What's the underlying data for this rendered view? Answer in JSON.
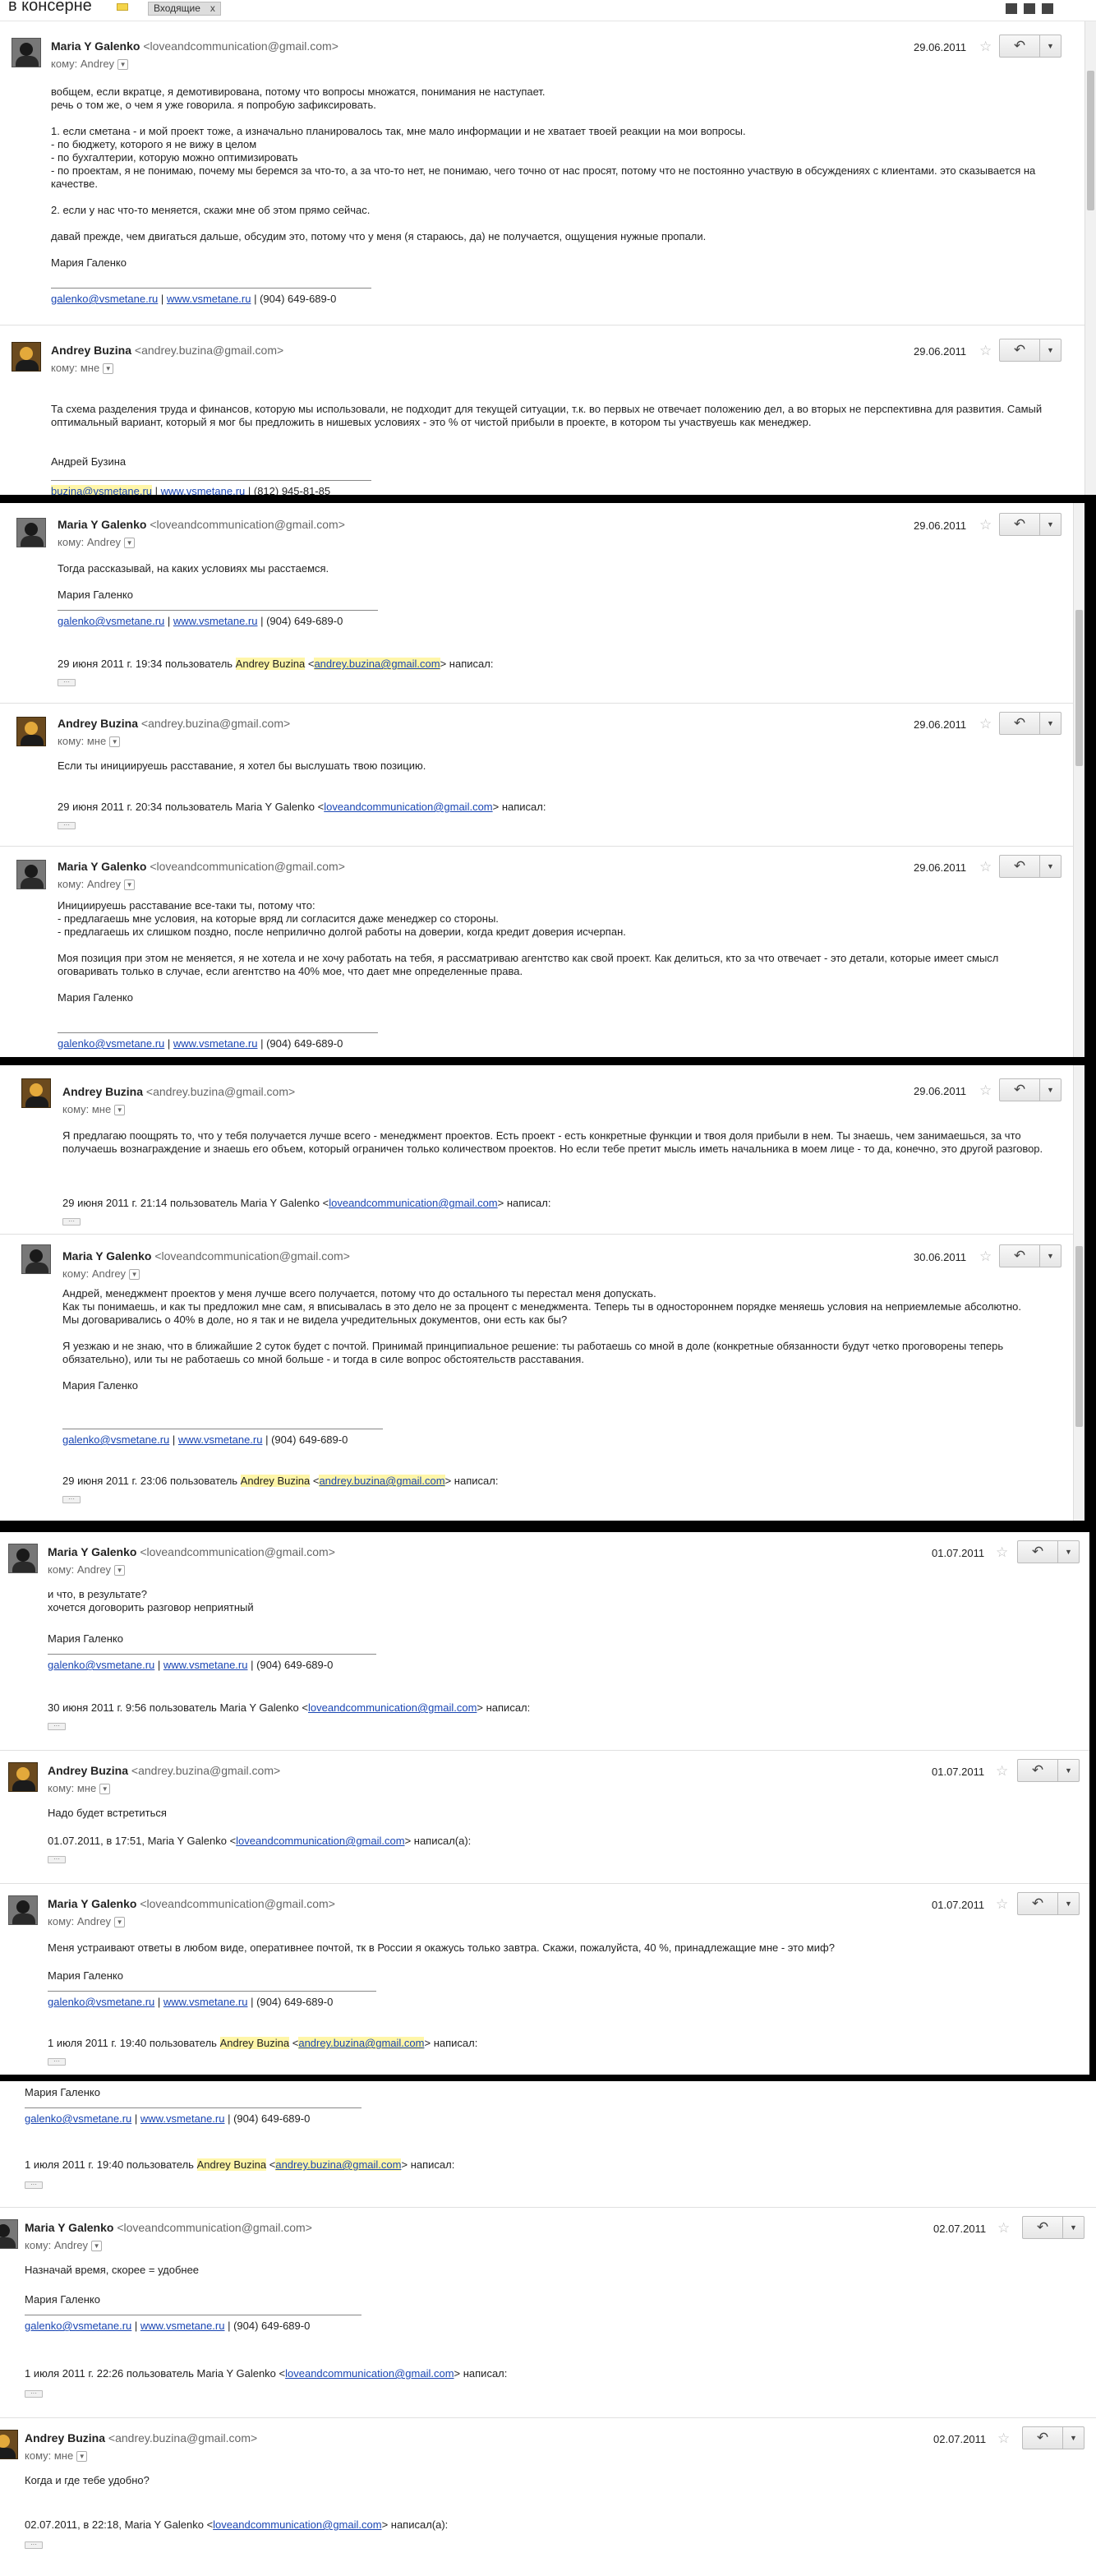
{
  "header": {
    "title": "в консерне",
    "chip_label": "Входящие",
    "chip_close": "x"
  },
  "p1": {
    "m1": {
      "name": "Maria Y Galenko",
      "email": "<loveandcommunication@gmail.com>",
      "to": "кому: Andrey",
      "date": "29.06.2011",
      "lines": [
        "вобщем, если вкратце, я демотивирована, потому что вопросы множатся, понимания не наступает.",
        "речь о том же, о чем я уже говорила. я попробую зафиксировать.",
        "",
        "1. если сметана - и мой проект тоже, а изначально планировалось так, мне мало информации и не хватает твоей реакции на мои вопросы.",
        "- по бюджету, которого я не вижу в целом",
        "- по бухгалтерии, которую можно оптимизировать",
        "- по проектам, я не понимаю, почему мы беремся за что-то, а за что-то нет, не понимаю, чего точно от нас просят, потому что не постоянно участвую в обсуждениях с клиентами. это сказывается на качестве.",
        "",
        "2. если у нас что-то меняется, скажи мне об этом прямо сейчас.",
        "",
        "давай прежде, чем двигаться дальше, обсудим это, потому что у меня (я стараюсь, да) не получается, ощущения нужные пропали.",
        "",
        "Мария Галенко"
      ],
      "sig_email": "galenko@vsmetane.ru",
      "sig_site": "www.vsmetane.ru",
      "sig_phone": "(904) 649-689-0"
    },
    "m2": {
      "name": "Andrey Buzina",
      "email": "<andrey.buzina@gmail.com>",
      "to": "кому: мне",
      "date": "29.06.2011",
      "lines": [
        "Та схема разделения труда и финансов, которую мы использовали, не подходит для текущей ситуации, т.к. во первых не отвечает положению дел, а во вторых не перспективна для развития. Самый оптимальный вариант, который я мог бы предложить в нишевых условиях - это % от чистой прибыли в проекте, в котором ты участвуешь как менеджер.",
        "",
        "",
        "Андрей Бузина"
      ],
      "sig_email": "buzina@vsmetane.ru",
      "sig_site": "www.vsmetane.ru",
      "sig_phone": "(812) 945-81-85"
    }
  },
  "p2": {
    "m1": {
      "name": "Maria Y Galenko",
      "email": "<loveandcommunication@gmail.com>",
      "to": "кому: Andrey",
      "date": "29.06.2011",
      "text": "Тогда рассказывай, на каких условиях мы расстаемся.",
      "signame": "Мария Галенко",
      "sig_email": "galenko@vsmetane.ru",
      "sig_site": "www.vsmetane.ru",
      "sig_phone": "(904) 649-689-0",
      "q_pre": "29 июня 2011 г. 19:34 пользователь ",
      "q_name": "Andrey Buzina",
      "q_email": "andrey.buzina@gmail.com",
      "q_post": " написал:"
    },
    "m2": {
      "name": "Andrey Buzina",
      "email": "<andrey.buzina@gmail.com>",
      "to": "кому: мне",
      "date": "29.06.2011",
      "text": "Если ты инициируешь расставание, я хотел бы выслушать твою позицию.",
      "q_pre": "29 июня 2011 г. 20:34 пользователь Maria Y Galenko ",
      "q_email": "loveandcommunication@gmail.com",
      "q_post": " написал:"
    },
    "m3": {
      "name": "Maria Y Galenko",
      "email": "<loveandcommunication@gmail.com>",
      "to": "кому: Andrey",
      "date": "29.06.2011",
      "lines": [
        "Инициируешь расставание все-таки ты, потому что:",
        "- предлагаешь мне условия, на которые вряд ли согласится даже менеджер со стороны.",
        "- предлагаешь их слишком поздно, после неприлично долгой работы на доверии, когда кредит доверия исчерпан.",
        "",
        "Моя позиция при этом не меняется, я не хотела и не хочу работать на тебя, я рассматриваю агентство как свой проект. Как делиться, кто за что отвечает - это детали, которые имеет смысл оговаривать только в случае, если агентство на 40% мое, что дает мне определенные права.",
        "",
        "Мария Галенко"
      ],
      "sig_email": "galenko@vsmetane.ru",
      "sig_site": "www.vsmetane.ru",
      "sig_phone": "(904) 649-689-0"
    }
  },
  "p3": {
    "m1": {
      "name": "Andrey Buzina",
      "email": "<andrey.buzina@gmail.com>",
      "to": "кому: мне",
      "date": "29.06.2011",
      "lines": [
        "Я предлагаю поощрять то, что у тебя получается лучше всего - менеджмент проектов. Есть проект - есть конкретные функции и твоя доля прибыли в нем. Ты знаешь, чем занимаешься, за что получаешь вознаграждение и знаешь его объем, который ограничен только количеством проектов. Но если тебе претит мысль иметь начальника в моем лице - то да, конечно, это другой разговор."
      ],
      "q_pre": "29 июня 2011 г. 21:14 пользователь Maria Y Galenko ",
      "q_email": "loveandcommunication@gmail.com",
      "q_post": " написал:"
    },
    "m2": {
      "name": "Maria Y Galenko",
      "email": "<loveandcommunication@gmail.com>",
      "to": "кому: Andrey",
      "date": "30.06.2011",
      "lines": [
        "Андрей, менеджмент проектов у меня лучше всего получается, потому что до остального ты перестал меня допускать.",
        "Как ты понимаешь, и как ты предложил мне сам, я вписывалась в это дело не за процент с менеджмента. Теперь ты в одностороннем порядке меняешь условия на неприемлемые абсолютно.",
        "Мы договаривались о 40% в доле, но я так и не видела учредительных документов, они есть как бы?",
        "",
        "Я уезжаю и не знаю, что в ближайшие 2 суток будет с почтой. Принимай принципиальное решение: ты работаешь со мной в доле (конкретные обязанности будут четко проговорены теперь обязательно), или ты не работаешь со мной больше - и тогда в силе вопрос обстоятельств расставания.",
        "",
        "Мария Галенко"
      ],
      "sig_email": "galenko@vsmetane.ru",
      "sig_site": "www.vsmetane.ru",
      "sig_phone": "(904) 649-689-0",
      "q_pre": "29 июня 2011 г. 23:06 пользователь ",
      "q_name": "Andrey Buzina",
      "q_email": "andrey.buzina@gmail.com",
      "q_post": " написал:"
    }
  },
  "p4": {
    "m1": {
      "name": "Maria Y Galenko",
      "email": "<loveandcommunication@gmail.com>",
      "to": "кому: Andrey",
      "date": "01.07.2011",
      "lines": [
        "и что, в результате?",
        "хочется договорить разговор неприятный"
      ],
      "signame": "Мария Галенко",
      "sig_email": "galenko@vsmetane.ru",
      "sig_site": "www.vsmetane.ru",
      "sig_phone": "(904) 649-689-0",
      "q_pre": "30 июня 2011 г. 9:56 пользователь Maria Y Galenko ",
      "q_email": "loveandcommunication@gmail.com",
      "q_post": " написал:"
    },
    "m2": {
      "name": "Andrey Buzina",
      "email": "<andrey.buzina@gmail.com>",
      "to": "кому: мне",
      "date": "01.07.2011",
      "text": "Надо будет встретиться",
      "q_pre": "01.07.2011, в 17:51, Maria Y Galenko ",
      "q_email": "loveandcommunication@gmail.com",
      "q_post": " написал(а):"
    },
    "m3": {
      "name": "Maria Y Galenko",
      "email": "<loveandcommunication@gmail.com>",
      "to": "кому: Andrey",
      "date": "01.07.2011",
      "text": "Меня устраивают ответы в любом виде, оперативнее почтой, тк в России я окажусь только завтра. Скажи, пожалуйста, 40 %, принадлежащие мне - это миф?",
      "signame": "Мария Галенко",
      "sig_email": "galenko@vsmetane.ru",
      "sig_site": "www.vsmetane.ru",
      "sig_phone": "(904) 649-689-0",
      "q_pre": "1 июля 2011 г. 19:40 пользователь ",
      "q_name": "Andrey Buzina",
      "q_email": "andrey.buzina@gmail.com",
      "q_post": " написал:"
    }
  },
  "p5": {
    "top": {
      "signame": "Мария Галенко",
      "sig_email": "galenko@vsmetane.ru",
      "sig_site": "www.vsmetane.ru",
      "sig_phone": "(904) 649-689-0",
      "q_pre": "1 июля 2011 г. 19:40 пользователь ",
      "q_name": "Andrey Buzina",
      "q_email": "andrey.buzina@gmail.com",
      "q_post": " написал:"
    },
    "m1": {
      "name": "Maria Y Galenko",
      "email": "<loveandcommunication@gmail.com>",
      "to": "кому: Andrey",
      "date": "02.07.2011",
      "text": "Назначай время, скорее = удобнее",
      "signame": "Мария Галенко",
      "sig_email": "galenko@vsmetane.ru",
      "sig_site": "www.vsmetane.ru",
      "sig_phone": "(904) 649-689-0",
      "q_pre": "1 июля 2011 г. 22:26 пользователь Maria Y Galenko ",
      "q_email": "loveandcommunication@gmail.com",
      "q_post": " написал:"
    },
    "m2": {
      "name": "Andrey Buzina",
      "email": "<andrey.buzina@gmail.com>",
      "to": "кому: мне",
      "date": "02.07.2011",
      "text": "Когда и где тебе удобно?",
      "q_pre": "02.07.2011, в 22:18, Maria Y Galenko ",
      "q_email": "loveandcommunication@gmail.com",
      "q_post": " написал(а):"
    }
  },
  "icons": {
    "star": "☆",
    "reply": "↶",
    "more": "▼",
    "dd": "▼",
    "ellipsis": "···"
  }
}
